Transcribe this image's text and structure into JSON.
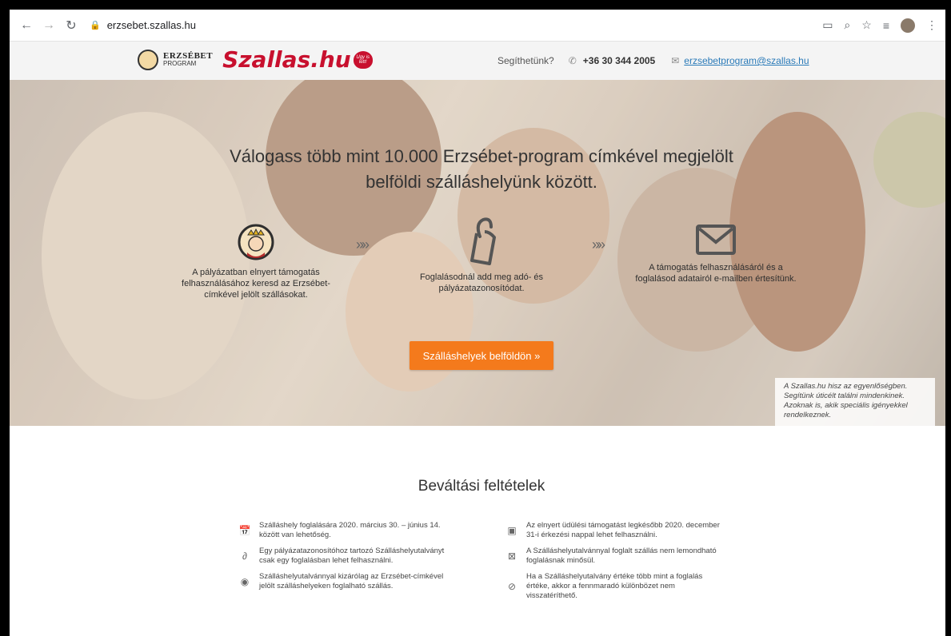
{
  "browser": {
    "url": "erzsebet.szallas.hu"
  },
  "header": {
    "erzsebet_title": "ERZSÉBET",
    "erzsebet_sub": "PROGRAM",
    "brand": "Szallas.hu",
    "brand_badge": "Ugy is lett!",
    "help_text": "Segíthetünk?",
    "phone": "+36 30 344 2005",
    "email": "erzsebetprogram@szallas.hu"
  },
  "hero": {
    "title_line1": "Válogass több mint 10.000 Erzsébet-program címkével megjelölt",
    "title_line2": "belföldi szálláshelyünk között.",
    "steps": [
      {
        "icon": "queen-seal-icon",
        "text": "A pályázatban elnyert támogatás felhasználásához keresd az Erzsébet-címkével jelölt szállásokat."
      },
      {
        "icon": "tag-icon",
        "text": "Foglalásodnál add meg adó- és pályázatazonosítódat."
      },
      {
        "icon": "envelope-icon",
        "text": "A támogatás felhasználásáról és a foglalásod adatairól e-mailben értesítünk."
      }
    ],
    "arrows": "»»",
    "cta_label": "Szálláshelyek belföldön »",
    "equality_note": "A Szallas.hu hisz az egyenlőségben. Segítünk úticélt találni mindenkinek. Azoknak is, akik speciális igényekkel rendelkeznek."
  },
  "conditions": {
    "title": "Beváltási feltételek",
    "left": [
      {
        "icon": "calendar-icon",
        "text": "Szálláshely foglalására 2020. március 30. – június 14. között van lehetőség."
      },
      {
        "icon": "tag-icon",
        "text": "Egy pályázatazonosítóhoz tartozó Szálláshelyutalványt csak egy foglalásban lehet felhasználni."
      },
      {
        "icon": "erzsebet-badge-icon",
        "text": "Szálláshelyutalvánnyal kizárólag az Erzsébet-címkével jelölt szálláshelyeken foglalható szállás."
      }
    ],
    "right": [
      {
        "icon": "calendar-day-icon",
        "text": "Az elnyert üdülési támogatást legkésőbb 2020. december 31-i érkezési nappal lehet felhasználni."
      },
      {
        "icon": "calendar-cancel-icon",
        "text": "A Szálláshelyutalvánnyal foglalt szállás nem lemondható foglalásnak minősül."
      },
      {
        "icon": "no-refund-icon",
        "text": "Ha a Szálláshelyutalvány értéke több mint a foglalás értéke, akkor a fennmaradó különbözet nem visszatéríthető."
      }
    ]
  }
}
